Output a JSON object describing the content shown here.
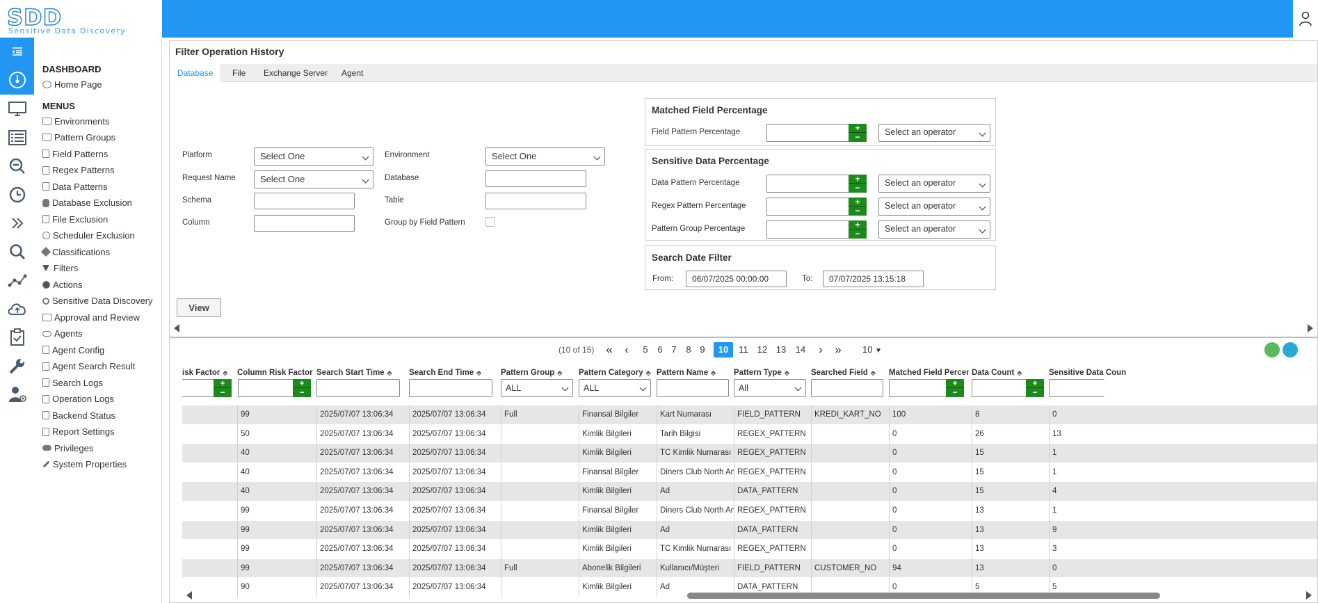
{
  "app": {
    "logo_main": "SDD",
    "logo_sub": "Sensitive Data Discovery"
  },
  "sidebar": {
    "dashboard_heading": "DASHBOARD",
    "home": "Home Page",
    "menus_heading": "MENUS",
    "items": [
      "Environments",
      "Pattern Groups",
      "Field Patterns",
      "Regex Patterns",
      "Data Patterns",
      "Database Exclusion",
      "File Exclusion",
      "Scheduler Exclusion",
      "Classifications",
      "Filters",
      "Actions",
      "Sensitive Data Discovery",
      "Approval and Review",
      "Agents",
      "Agent Config",
      "Agent Search Result",
      "Search Logs",
      "Operation Logs",
      "Backend Status",
      "Report Settings",
      "Privileges",
      "System Properties"
    ]
  },
  "rail_icons": [
    "menu-toggle-icon",
    "dashboard-gauge-icon",
    "monitor-icon",
    "list-icon",
    "search-zoom-icon",
    "clock-icon",
    "double-chevron-icon",
    "search-icon",
    "network-icon",
    "cloud-upload-icon",
    "clipboard-check-icon",
    "wrench-icon",
    "user-settings-icon"
  ],
  "panel": {
    "title": "Filter Operation History",
    "tabs": [
      "Database",
      "File",
      "Exchange Server",
      "Agent"
    ]
  },
  "filters": {
    "platform_label": "Platform",
    "platform_value": "Select One",
    "environment_label": "Environment",
    "environment_value": "Select One",
    "request_name_label": "Request Name",
    "request_name_value": "Select One",
    "database_label": "Database",
    "schema_label": "Schema",
    "table_label": "Table",
    "column_label": "Column",
    "group_by_label": "Group by Field Pattern",
    "view_button": "View"
  },
  "matched_field": {
    "title": "Matched Field Percentage",
    "field_pattern_label": "Field Pattern Percentage",
    "operator_placeholder": "Select an operator"
  },
  "sensitive_data": {
    "title": "Sensitive Data Percentage",
    "data_pattern_label": "Data Pattern Percentage",
    "regex_pattern_label": "Regex Pattern Percentage",
    "pattern_group_label": "Pattern Group Percentage",
    "operator_placeholder": "Select an operator"
  },
  "date_filter": {
    "title": "Search Date Filter",
    "from_label": "From:",
    "from_value": "06/07/2025 00:00:00",
    "to_label": "To:",
    "to_value": "07/07/2025 13:15:18"
  },
  "pager": {
    "info": "(10 of 15)",
    "first": "«",
    "prev": "‹",
    "pages": [
      "5",
      "6",
      "7",
      "8",
      "9",
      "10",
      "11",
      "12",
      "13",
      "14"
    ],
    "current": "10",
    "next": "›",
    "last": "»",
    "rows_per_page": "10"
  },
  "grid": {
    "headers": [
      "isk Factor",
      "Column Risk Factor",
      "Search Start Time",
      "Search End Time",
      "Pattern Group",
      "Pattern Category",
      "Pattern Name",
      "Pattern Type",
      "Searched Field",
      "Matched Field Percentage",
      "Data Count",
      "Sensitive Data Coun"
    ],
    "filter_all": "ALL",
    "filter_all_type": "All",
    "rows": [
      [
        "",
        "99",
        "2025/07/07 13:06:34",
        "2025/07/07 13:06:34",
        "Full",
        "Finansal Bilgiler",
        "Kart Numarası",
        "FIELD_PATTERN",
        "KREDI_KART_NO",
        "100",
        "8",
        "0"
      ],
      [
        "",
        "50",
        "2025/07/07 13:06:34",
        "2025/07/07 13:06:34",
        "",
        "Kimlik Bilgileri",
        "Tarih Bilgisi",
        "REGEX_PATTERN",
        "",
        "0",
        "26",
        "13"
      ],
      [
        "",
        "40",
        "2025/07/07 13:06:34",
        "2025/07/07 13:06:34",
        "",
        "Kimlik Bilgileri",
        "TC Kimlik Numarası",
        "REGEX_PATTERN",
        "",
        "0",
        "15",
        "1"
      ],
      [
        "",
        "40",
        "2025/07/07 13:06:34",
        "2025/07/07 13:06:34",
        "",
        "Finansal Bilgiler",
        "Diners Club North Ameri",
        "REGEX_PATTERN",
        "",
        "0",
        "15",
        "1"
      ],
      [
        "",
        "40",
        "2025/07/07 13:06:34",
        "2025/07/07 13:06:34",
        "",
        "Kimlik Bilgileri",
        "Ad",
        "DATA_PATTERN",
        "",
        "0",
        "15",
        "4"
      ],
      [
        "",
        "99",
        "2025/07/07 13:06:34",
        "2025/07/07 13:06:34",
        "",
        "Finansal Bilgiler",
        "Diners Club North Ameri",
        "REGEX_PATTERN",
        "",
        "0",
        "13",
        "1"
      ],
      [
        "",
        "99",
        "2025/07/07 13:06:34",
        "2025/07/07 13:06:34",
        "",
        "Kimlik Bilgileri",
        "Ad",
        "DATA_PATTERN",
        "",
        "0",
        "13",
        "9"
      ],
      [
        "",
        "99",
        "2025/07/07 13:06:34",
        "2025/07/07 13:06:34",
        "",
        "Kimlik Bilgileri",
        "TC Kimlik Numarası",
        "REGEX_PATTERN",
        "",
        "0",
        "13",
        "3"
      ],
      [
        "",
        "99",
        "2025/07/07 13:06:34",
        "2025/07/07 13:06:34",
        "Full",
        "Abonelik Bilgileri",
        "Kullanıcı/Müşteri",
        "FIELD_PATTERN",
        "CUSTOMER_NO",
        "94",
        "13",
        "0"
      ],
      [
        "",
        "90",
        "2025/07/07 13:06:34",
        "2025/07/07 13:06:34",
        "",
        "Kimlik Bilgileri",
        "Ad",
        "DATA_PATTERN",
        "",
        "0",
        "5",
        "5"
      ]
    ]
  },
  "colors": {
    "brand_blue": "#2196f3",
    "spinner_green": "#1e8a1e",
    "row_stripe": "#e6e6e6"
  }
}
